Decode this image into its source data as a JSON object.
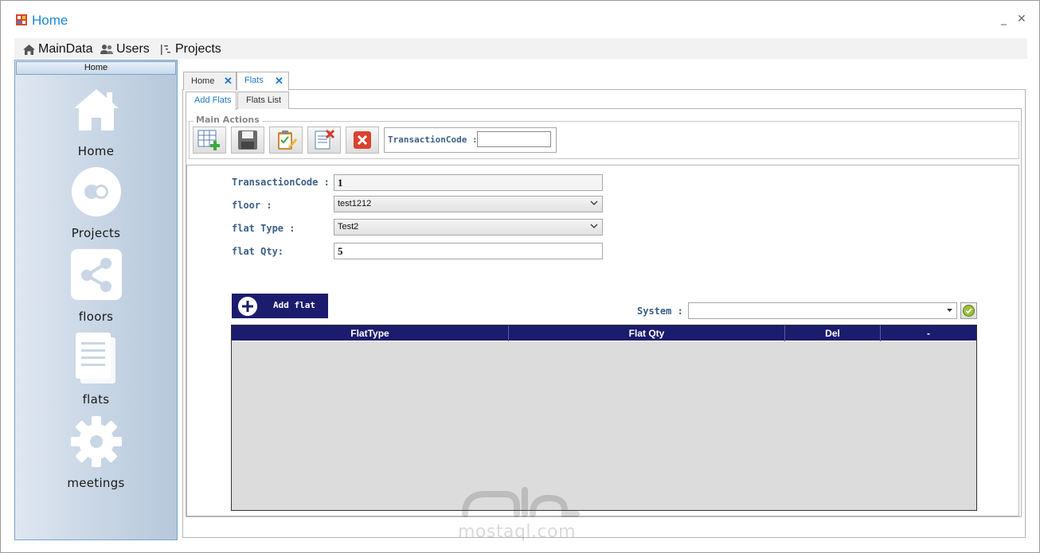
{
  "window": {
    "title": "Home",
    "minimize": "_",
    "close": "✕"
  },
  "menu": {
    "items": [
      {
        "label": "MainData",
        "icon": "house-icon"
      },
      {
        "label": "Users",
        "icon": "users-icon"
      },
      {
        "label": "Projects",
        "icon": "projects-icon"
      }
    ]
  },
  "sidebar": {
    "header": "Home",
    "items": [
      {
        "label": "Home",
        "icon": "house-icon"
      },
      {
        "label": "Projects",
        "icon": "projects-circle-icon"
      },
      {
        "label": "floors",
        "icon": "share-icon"
      },
      {
        "label": "flats",
        "icon": "document-icon"
      },
      {
        "label": "meetings",
        "icon": "gear-icon"
      }
    ]
  },
  "tabs": [
    {
      "label": "Home",
      "close": "✕",
      "active": false
    },
    {
      "label": "Flats",
      "close": "✕",
      "active": true
    }
  ],
  "subtabs": [
    {
      "label": "Add Flats",
      "active": true
    },
    {
      "label": "Flats List",
      "active": false
    }
  ],
  "actions": {
    "legend": "Main Actions",
    "buttons": [
      "new-grid-icon",
      "save-icon",
      "edit-clipboard-icon",
      "delete-document-icon",
      "cancel-icon"
    ],
    "transaction_label": "TransactionCode :",
    "transaction_value": ""
  },
  "form": {
    "transaction_label": "TransactionCode :",
    "transaction_value": "1",
    "floor_label": "floor  :",
    "floor_value": "test1212",
    "flat_type_label": "flat Type :",
    "flat_type_value": "Test2",
    "flat_qty_label": "flat Qty:",
    "flat_qty_value": "5"
  },
  "add_flat": {
    "label": "Add flat"
  },
  "system": {
    "label": "System :",
    "value": ""
  },
  "grid": {
    "columns": [
      "FlatType",
      "Flat Qty",
      "Del",
      "-"
    ],
    "rows": []
  },
  "watermark": {
    "text": "mostaql.com"
  },
  "colors": {
    "accent": "#1e78c8",
    "navy": "#1c1c6e",
    "label": "#3a5f87"
  }
}
